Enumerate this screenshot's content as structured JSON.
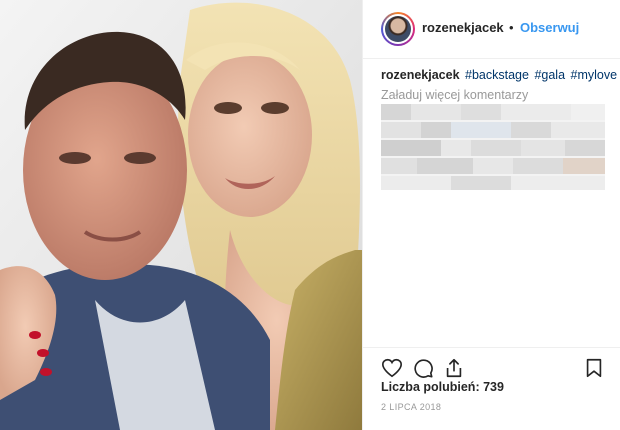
{
  "header": {
    "username": "rozenekjacek",
    "separator": "•",
    "follow_label": "Obserwuj"
  },
  "caption": {
    "username": "rozenekjacek",
    "hashtags": [
      "#backstage",
      "#gala",
      "#mylove"
    ]
  },
  "comments": {
    "load_more_label": "Załaduj więcej komentarzy"
  },
  "actions": {
    "icons": [
      "heart-icon",
      "comment-icon",
      "share-icon",
      "bookmark-icon"
    ]
  },
  "likes_text": "Liczba polubień: 739",
  "date_text": "2 LIPCA 2018",
  "colors": {
    "link": "#3897f0",
    "hashtag": "#003569",
    "muted": "#999999",
    "divider": "#efefef"
  }
}
